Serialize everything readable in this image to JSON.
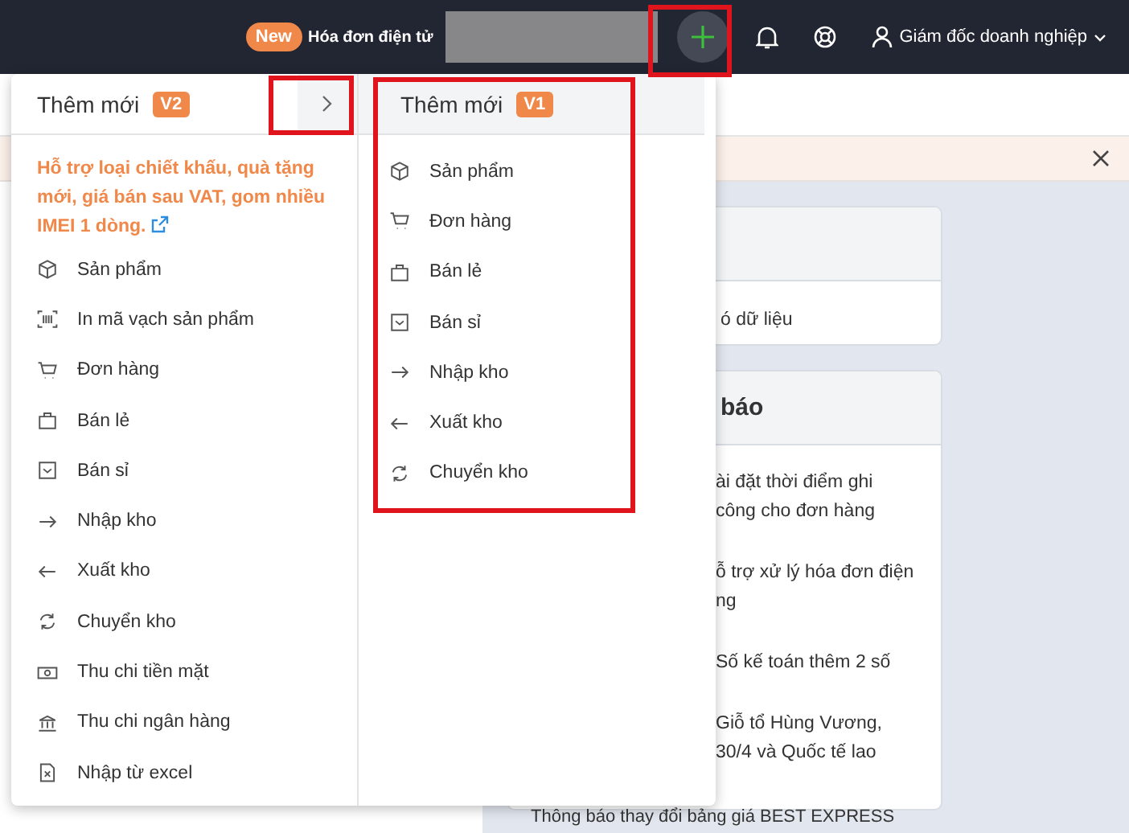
{
  "topbar": {
    "badge": "New",
    "title": "Hóa đơn điện tử",
    "user": "Giám đốc doanh nghiệp"
  },
  "cards": [
    {
      "body": "ó dữ liệu"
    },
    {
      "title": "báo",
      "notices": [
        "ài đặt thời điểm ghi\ncông cho đơn hàng",
        "ỗ trợ xử lý hóa đơn điện\nng",
        "Số kế toán thêm 2 số",
        "Giỗ tổ Hùng Vương,\n30/4 và Quốc tế lao"
      ]
    }
  ],
  "last_notice": "Thông báo thay đổi bảng giá BEST EXPRESS",
  "menu_v2": {
    "title": "Thêm mới",
    "version": "V2",
    "note": "Hỗ trợ loại chiết khấu, quà tặng mới, giá bán sau VAT, gom nhiều IMEI 1 dòng.",
    "items": [
      {
        "kind": "box",
        "label": "Sản phẩm"
      },
      {
        "kind": "barcode",
        "label": "In mã vạch sản phẩm"
      },
      {
        "kind": "cart",
        "label": "Đơn hàng"
      },
      {
        "kind": "bag",
        "label": "Bán lẻ"
      },
      {
        "kind": "tray",
        "label": "Bán sỉ"
      },
      {
        "kind": "in",
        "label": "Nhập kho"
      },
      {
        "kind": "out",
        "label": "Xuất kho"
      },
      {
        "kind": "transfer",
        "label": "Chuyển kho"
      },
      {
        "kind": "cash",
        "label": "Thu chi tiền mặt"
      },
      {
        "kind": "bank",
        "label": "Thu chi ngân hàng"
      },
      {
        "kind": "file",
        "label": "Nhập từ excel"
      }
    ]
  },
  "menu_v1": {
    "title": "Thêm mới",
    "version": "V1",
    "items": [
      {
        "kind": "box",
        "label": "Sản phẩm"
      },
      {
        "kind": "cart",
        "label": "Đơn hàng"
      },
      {
        "kind": "bag",
        "label": "Bán lẻ"
      },
      {
        "kind": "tray",
        "label": "Bán sỉ"
      },
      {
        "kind": "in",
        "label": "Nhập kho"
      },
      {
        "kind": "out",
        "label": "Xuất kho"
      },
      {
        "kind": "transfer",
        "label": "Chuyển kho"
      }
    ]
  }
}
